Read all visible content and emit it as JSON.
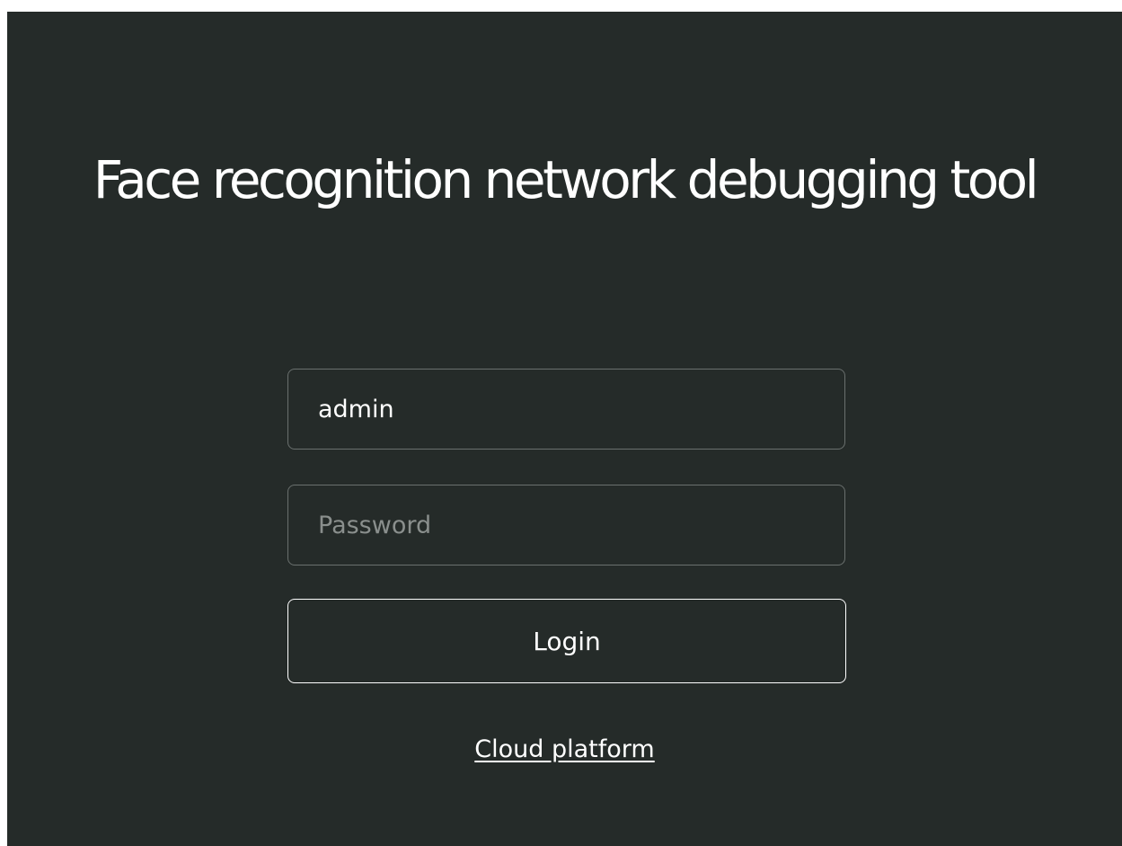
{
  "page": {
    "title": "Face recognition network debugging tool"
  },
  "login_form": {
    "username_value": "admin",
    "password_value": "",
    "password_placeholder": "Password",
    "login_label": "Login",
    "cloud_platform_label": "Cloud platform"
  },
  "colors": {
    "background": "#252b29",
    "text": "#ffffff",
    "border": "#6a706e",
    "placeholder": "#8a8f8d"
  }
}
